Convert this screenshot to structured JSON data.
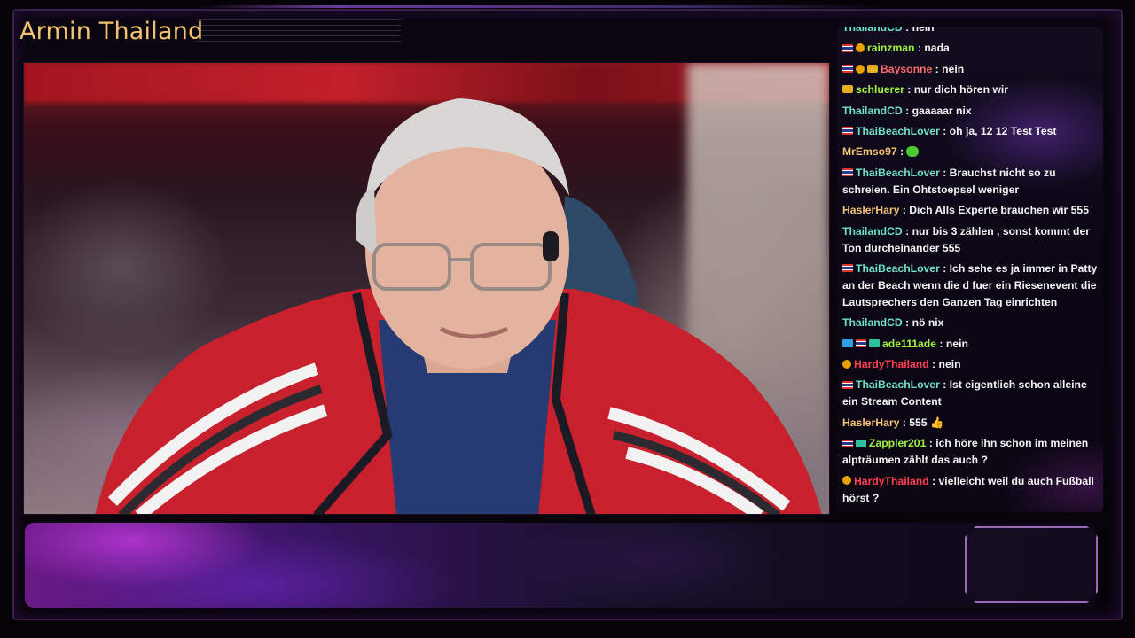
{
  "stream": {
    "title": "Armin Thailand"
  },
  "colors": {
    "title": "#f2c273",
    "accent_purple": "#9a6ab8"
  },
  "chat": {
    "messages": [
      {
        "user": "ThailandCD",
        "user_color": "#6fe0c8",
        "badges": [],
        "text": "nein"
      },
      {
        "user": "rainzman",
        "user_color": "#a0f040",
        "badges": [
          "flag",
          "coin"
        ],
        "text": "nada"
      },
      {
        "user": "Baysonne",
        "user_color": "#ff6a6a",
        "badges": [
          "flag",
          "coin",
          "crown"
        ],
        "text": "nein"
      },
      {
        "user": "schluerer",
        "user_color": "#a0f040",
        "badges": [
          "crown"
        ],
        "text": "nur dich hören wir"
      },
      {
        "user": "ThailandCD",
        "user_color": "#6fe0c8",
        "badges": [],
        "text": "gaaaaar nix"
      },
      {
        "user": "ThaiBeachLover",
        "user_color": "#6fe0c8",
        "badges": [
          "flag"
        ],
        "text": "oh ja, 12 12 Test Test"
      },
      {
        "user": "MrEmso97",
        "user_color": "#f2c273",
        "badges": [],
        "text": "",
        "emote": true
      },
      {
        "user": "ThaiBeachLover",
        "user_color": "#6fe0c8",
        "badges": [
          "flag"
        ],
        "text": "Brauchst nicht so zu schreien. Ein Ohtstoepsel weniger"
      },
      {
        "user": "HaslerHary",
        "user_color": "#f2c273",
        "badges": [],
        "text": "Dich Alls Experte brauchen wir 555"
      },
      {
        "user": "ThailandCD",
        "user_color": "#6fe0c8",
        "badges": [],
        "text": "nur bis 3 zählen , sonst kommt der Ton durcheinander 555"
      },
      {
        "user": "ThaiBeachLover",
        "user_color": "#6fe0c8",
        "badges": [
          "flag"
        ],
        "text": "Ich sehe es ja immer in Patty an der Beach wenn die d fuer ein Riesenevent die Lautsprechers den Ganzen Tag einrichten"
      },
      {
        "user": "ThailandCD",
        "user_color": "#6fe0c8",
        "badges": [],
        "text": "nö nix"
      },
      {
        "user": "ade111ade",
        "user_color": "#a0f040",
        "badges": [
          "blue",
          "flag",
          "teal"
        ],
        "text": "nein"
      },
      {
        "user": "HardyThailand",
        "user_color": "#ff4050",
        "badges": [
          "coin"
        ],
        "text": "nein"
      },
      {
        "user": "ThaiBeachLover",
        "user_color": "#6fe0c8",
        "badges": [
          "flag"
        ],
        "text": "Ist eigentlich schon alleine ein Stream Content"
      },
      {
        "user": "HaslerHary",
        "user_color": "#f2c273",
        "badges": [],
        "text": "555 👍"
      },
      {
        "user": "Zappler201",
        "user_color": "#a0f040",
        "badges": [
          "flag",
          "teal"
        ],
        "text": "ich höre ihn schon im meinen alpträumen zählt das auch ?"
      },
      {
        "user": "HardyThailand",
        "user_color": "#ff4050",
        "badges": [
          "coin"
        ],
        "text": "vielleicht weil du auch Fußball hörst ?"
      }
    ]
  }
}
